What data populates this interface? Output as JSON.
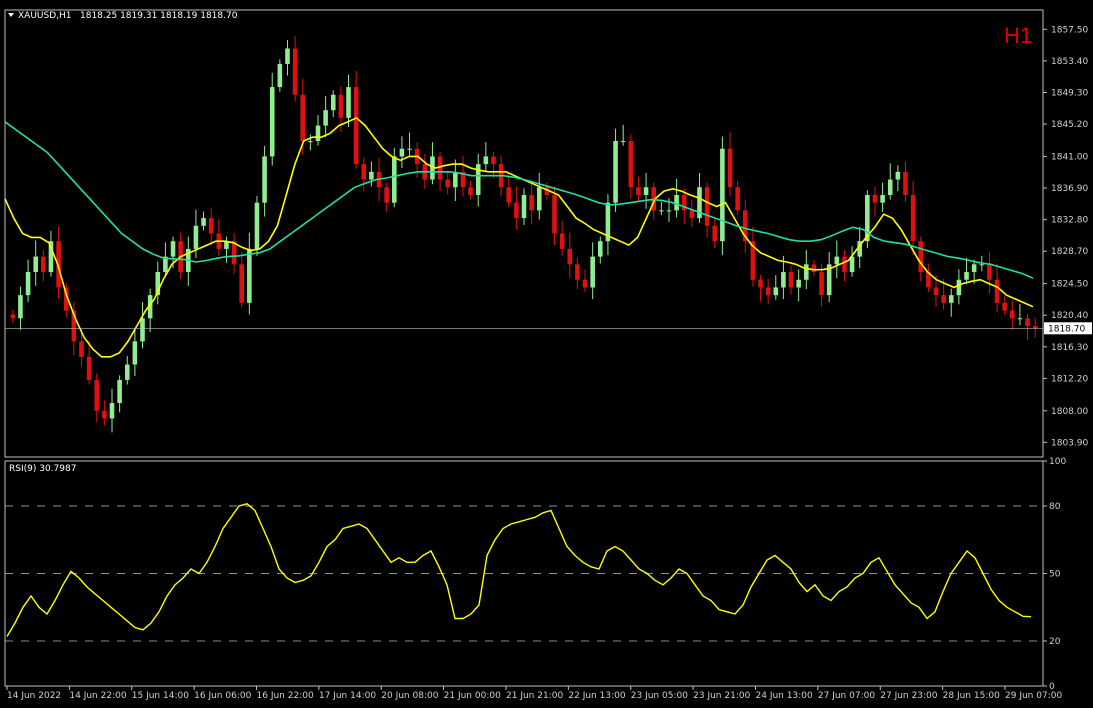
{
  "header": {
    "symbol": "XAUUSD,H1",
    "ohlc": "1818.25 1819.31 1818.19 1818.70",
    "timeframe": "H1"
  },
  "rsi_header": "RSI(9) 30.7987",
  "colors": {
    "background": "#000000",
    "bull_candle": "#90ee90",
    "bear_candle": "#e01010",
    "ma_fast": "#ffff00",
    "ma_slow": "#20e0a0",
    "rsi_line": "#ffff00",
    "price_line": "#c0c0c0"
  },
  "chart_data": [
    {
      "type": "candlestick",
      "title": "XAUUSD,H1",
      "y_ticks": [
        "1857.50",
        "1853.40",
        "1849.30",
        "1845.20",
        "1841.00",
        "1836.90",
        "1832.80",
        "1828.70",
        "1824.50",
        "1820.40",
        "1816.30",
        "1812.20",
        "1808.00",
        "1803.90"
      ],
      "ylim": [
        1802,
        1860
      ],
      "current_price": "1818.70",
      "x_labels": [
        "14 Jun 2022",
        "14 Jun 22:00",
        "15 Jun 14:00",
        "16 Jun 06:00",
        "16 Jun 22:00",
        "17 Jun 14:00",
        "20 Jun 08:00",
        "21 Jun 00:00",
        "21 Jun 21:00",
        "22 Jun 13:00",
        "23 Jun 05:00",
        "23 Jun 21:00",
        "24 Jun 13:00",
        "27 Jun 07:00",
        "27 Jun 23:00",
        "28 Jun 15:00",
        "29 Jun 07:00"
      ],
      "series": [
        {
          "kind": "close",
          "values": [
            1820,
            1823,
            1826,
            1828,
            1826,
            1830,
            1824,
            1821,
            1817,
            1815,
            1812,
            1808,
            1807,
            1809,
            1812,
            1814,
            1817,
            1820,
            1823,
            1826,
            1828,
            1830,
            1826,
            1829,
            1832,
            1833,
            1831,
            1829,
            1830,
            1827,
            1822,
            1829,
            1835,
            1841,
            1850,
            1853,
            1855,
            1849,
            1843,
            1843,
            1845,
            1847,
            1849,
            1846,
            1850,
            1840,
            1838,
            1839,
            1837,
            1835,
            1841,
            1842,
            1842,
            1840,
            1838,
            1841,
            1838,
            1837,
            1839,
            1837,
            1836,
            1840,
            1841,
            1840,
            1837,
            1835,
            1833,
            1836,
            1834,
            1837,
            1836,
            1831,
            1829,
            1827,
            1825,
            1824,
            1828,
            1830,
            1835,
            1843,
            1843,
            1837,
            1836,
            1837,
            1834,
            1834,
            1834,
            1836,
            1834,
            1833,
            1837,
            1832,
            1830,
            1842,
            1837,
            1834,
            1830,
            1825,
            1824,
            1823,
            1824,
            1826,
            1824,
            1825,
            1827,
            1826,
            1823,
            1827,
            1828,
            1826,
            1828,
            1830,
            1836,
            1835,
            1836,
            1838,
            1839,
            1836,
            1830,
            1826,
            1824,
            1823,
            1822,
            1823,
            1825,
            1826,
            1827,
            1827,
            1825,
            1822,
            1821,
            1820,
            1820,
            1819,
            1818.7
          ]
        },
        {
          "kind": "ma",
          "color_key": "ma_fast",
          "values": [
            1835.5,
            1833,
            1831,
            1830.5,
            1830.5,
            1829.8,
            1827,
            1823,
            1820,
            1817.5,
            1816,
            1815,
            1815,
            1815.5,
            1817,
            1819,
            1821,
            1822.5,
            1825,
            1827,
            1828,
            1828.5,
            1829,
            1829.5,
            1830,
            1830,
            1829.8,
            1829.2,
            1828.8,
            1829,
            1830,
            1832,
            1836,
            1840,
            1843,
            1843.5,
            1843.5,
            1844,
            1845,
            1845.5,
            1846,
            1845,
            1843.5,
            1842,
            1841,
            1840.5,
            1841,
            1841,
            1840,
            1839.5,
            1839.8,
            1840,
            1840,
            1839.5,
            1839.2,
            1839,
            1839,
            1839,
            1838.5,
            1838,
            1837.5,
            1837,
            1836.5,
            1836,
            1834.5,
            1833,
            1832.3,
            1831.5,
            1831,
            1830.5,
            1830,
            1829.5,
            1830.5,
            1833,
            1835.5,
            1836.5,
            1836.8,
            1836.5,
            1836,
            1835.6,
            1835,
            1834.5,
            1835,
            1833,
            1831,
            1829.5,
            1828.5,
            1828,
            1827.5,
            1827.3,
            1827,
            1826.5,
            1826.3,
            1826.3,
            1826.5,
            1827,
            1827.5,
            1829,
            1830.5,
            1831.8,
            1833.5,
            1833,
            1831.5,
            1829.5,
            1827.5,
            1826,
            1825,
            1824.5,
            1824,
            1824.5,
            1824.8,
            1825,
            1824.5,
            1824,
            1823,
            1822.5,
            1822,
            1821.5
          ]
        },
        {
          "kind": "ma",
          "color_key": "ma_slow",
          "values": [
            1845.5,
            1844.5,
            1843.5,
            1842.5,
            1841.5,
            1840,
            1838.5,
            1837,
            1835.5,
            1834,
            1832.5,
            1831,
            1830,
            1829,
            1828.3,
            1827.8,
            1827.7,
            1827.6,
            1827.3,
            1827.5,
            1827.8,
            1828,
            1828.1,
            1828.3,
            1828.5,
            1829,
            1830,
            1831,
            1832,
            1833,
            1834,
            1835,
            1836,
            1837,
            1837.5,
            1838,
            1838.2,
            1838.5,
            1838.8,
            1839,
            1839,
            1839,
            1839,
            1838.8,
            1838.5,
            1838.5,
            1838.5,
            1838.5,
            1838.3,
            1838,
            1837.6,
            1837.2,
            1836.8,
            1836.4,
            1836,
            1835.5,
            1835,
            1834.7,
            1834.8,
            1835,
            1835.2,
            1835.4,
            1835.3,
            1835,
            1834.5,
            1834,
            1833.5,
            1833,
            1832.5,
            1832,
            1831.6,
            1831.3,
            1831,
            1830.6,
            1830.2,
            1830,
            1830,
            1830.2,
            1830.7,
            1831.3,
            1831.8,
            1831.5,
            1830.5,
            1830,
            1829.8,
            1829.6,
            1829.2,
            1828.8,
            1828.4,
            1828,
            1827.8,
            1827.5,
            1827.2,
            1827,
            1826.6,
            1826.2,
            1825.8,
            1825.2
          ]
        }
      ]
    },
    {
      "type": "line",
      "title": "RSI(9) 30.7987",
      "y_ticks": [
        "100",
        "80",
        "50",
        "20",
        "0"
      ],
      "ylim": [
        0,
        100
      ],
      "levels": [
        20,
        50,
        80
      ],
      "series": [
        {
          "name": "RSI(9)",
          "values": [
            22,
            28,
            35,
            40,
            35,
            32,
            38,
            45,
            51,
            48,
            44,
            41,
            38,
            35,
            32,
            29,
            26,
            25,
            28,
            33,
            40,
            45,
            48,
            52,
            50,
            55,
            62,
            70,
            75,
            80,
            81,
            78,
            70,
            62,
            52,
            48,
            46,
            47,
            49,
            55,
            62,
            65,
            70,
            71,
            72,
            70,
            65,
            60,
            55,
            57,
            55,
            55,
            58,
            60,
            53,
            45,
            30,
            30,
            32,
            36,
            58,
            65,
            70,
            72,
            73,
            74,
            75,
            77,
            78,
            70,
            62,
            58,
            55,
            53,
            52,
            60,
            62,
            60,
            56,
            52,
            50,
            47,
            45,
            48,
            52,
            50,
            45,
            40,
            38,
            34,
            33,
            32,
            36,
            44,
            50,
            56,
            58,
            55,
            52,
            46,
            42,
            45,
            40,
            38,
            42,
            44,
            48,
            50,
            55,
            57,
            51,
            45,
            41,
            37,
            35,
            30,
            33,
            42,
            50,
            55,
            60,
            57,
            50,
            43,
            38,
            35,
            33,
            31,
            30.8
          ]
        }
      ]
    }
  ]
}
